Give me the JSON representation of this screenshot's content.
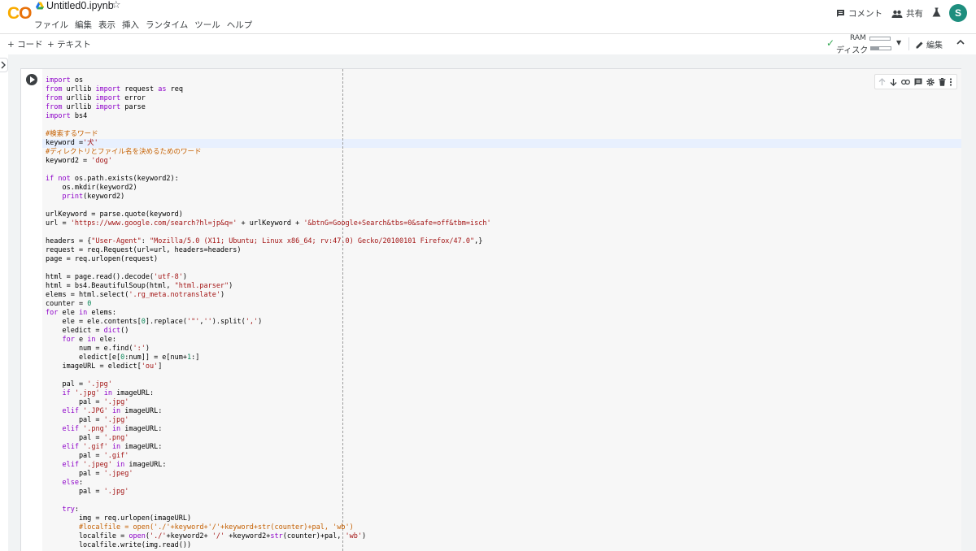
{
  "app": {
    "logo": {
      "part1": "C",
      "part2": "O"
    },
    "title": "Untitled0.ipynb",
    "star_glyph": "☆"
  },
  "menu": [
    "ファイル",
    "編集",
    "表示",
    "挿入",
    "ランタイム",
    "ツール",
    "ヘルプ"
  ],
  "header_actions": {
    "comment": "コメント",
    "share": "共有",
    "avatar_initial": "S"
  },
  "toolbar": {
    "add_code": "+ コード",
    "add_text": "+ テキスト",
    "ram_label": "RAM",
    "disk_label": "ディスク",
    "edit_label": "編集"
  },
  "cell": {
    "lines": [
      [
        [
          "kw",
          "import"
        ],
        [
          "p",
          " os"
        ]
      ],
      [
        [
          "kw",
          "from"
        ],
        [
          "p",
          " urllib "
        ],
        [
          "kw",
          "import"
        ],
        [
          "p",
          " request "
        ],
        [
          "kw",
          "as"
        ],
        [
          "p",
          " req"
        ]
      ],
      [
        [
          "kw",
          "from"
        ],
        [
          "p",
          " urllib "
        ],
        [
          "kw",
          "import"
        ],
        [
          "p",
          " error"
        ]
      ],
      [
        [
          "kw",
          "from"
        ],
        [
          "p",
          " urllib "
        ],
        [
          "kw",
          "import"
        ],
        [
          "p",
          " parse"
        ]
      ],
      [
        [
          "kw",
          "import"
        ],
        [
          "p",
          " bs4"
        ]
      ],
      [],
      [
        [
          "cmt",
          "#検索するワード"
        ]
      ],
      [
        [
          "p",
          "keyword ="
        ],
        [
          "str",
          "'犬'"
        ]
      ],
      [
        [
          "cmt",
          "#ディレクトリとファイル名を決めるためのワード"
        ]
      ],
      [
        [
          "p",
          "keyword2 = "
        ],
        [
          "str",
          "'dog'"
        ]
      ],
      [],
      [
        [
          "kw",
          "if not"
        ],
        [
          "p",
          " os.path.exists(keyword2):"
        ]
      ],
      [
        [
          "p",
          "    os.mkdir(keyword2)"
        ]
      ],
      [
        [
          "p",
          "    "
        ],
        [
          "kw",
          "print"
        ],
        [
          "p",
          "(keyword2)"
        ]
      ],
      [],
      [
        [
          "p",
          "urlKeyword = parse.quote(keyword)"
        ]
      ],
      [
        [
          "p",
          "url = "
        ],
        [
          "str",
          "'https://www.google.com/search?hl=jp&q='"
        ],
        [
          "p",
          " + urlKeyword + "
        ],
        [
          "str",
          "'&btnG=Google+Search&tbs=0&safe=off&tbm=isch'"
        ]
      ],
      [],
      [
        [
          "p",
          "headers = {"
        ],
        [
          "str",
          "\"User-Agent\""
        ],
        [
          "p",
          ": "
        ],
        [
          "str",
          "\"Mozilla/5.0 (X11; Ubuntu; Linux x86_64; rv:47.0) Gecko/20100101 Firefox/47.0\""
        ],
        [
          "p",
          ",}"
        ]
      ],
      [
        [
          "p",
          "request = req.Request(url=url, headers=headers)"
        ]
      ],
      [
        [
          "p",
          "page = req.urlopen(request)"
        ]
      ],
      [],
      [
        [
          "p",
          "html = page.read().decode("
        ],
        [
          "str",
          "'utf-8'"
        ],
        [
          "p",
          ")"
        ]
      ],
      [
        [
          "p",
          "html = bs4.BeautifulSoup(html, "
        ],
        [
          "str",
          "\"html.parser\""
        ],
        [
          "p",
          ")"
        ]
      ],
      [
        [
          "p",
          "elems = html.select("
        ],
        [
          "str",
          "'.rg_meta.notranslate'"
        ],
        [
          "p",
          ")"
        ]
      ],
      [
        [
          "p",
          "counter = "
        ],
        [
          "num",
          "0"
        ]
      ],
      [
        [
          "kw",
          "for"
        ],
        [
          "p",
          " ele "
        ],
        [
          "kw",
          "in"
        ],
        [
          "p",
          " elems:"
        ]
      ],
      [
        [
          "p",
          "    ele = ele.contents["
        ],
        [
          "num",
          "0"
        ],
        [
          "p",
          "].replace("
        ],
        [
          "str",
          "'\"'"
        ],
        [
          "p",
          ","
        ],
        [
          "str",
          "''"
        ],
        [
          "p",
          ").split("
        ],
        [
          "str",
          "','"
        ],
        [
          "p",
          ")"
        ]
      ],
      [
        [
          "p",
          "    eledict = "
        ],
        [
          "kw",
          "dict"
        ],
        [
          "p",
          "()"
        ]
      ],
      [
        [
          "p",
          "    "
        ],
        [
          "kw",
          "for"
        ],
        [
          "p",
          " e "
        ],
        [
          "kw",
          "in"
        ],
        [
          "p",
          " ele:"
        ]
      ],
      [
        [
          "p",
          "        num = e.find("
        ],
        [
          "str",
          "':'"
        ],
        [
          "p",
          ")"
        ]
      ],
      [
        [
          "p",
          "        eledict[e["
        ],
        [
          "num",
          "0"
        ],
        [
          "p",
          ":num]] = e[num+"
        ],
        [
          "num",
          "1"
        ],
        [
          "p",
          ":]"
        ]
      ],
      [
        [
          "p",
          "    imageURL = eledict["
        ],
        [
          "str",
          "'ou'"
        ],
        [
          "p",
          "]"
        ]
      ],
      [],
      [
        [
          "p",
          "    pal = "
        ],
        [
          "str",
          "'.jpg'"
        ]
      ],
      [
        [
          "p",
          "    "
        ],
        [
          "kw",
          "if"
        ],
        [
          "p",
          " "
        ],
        [
          "str",
          "'.jpg'"
        ],
        [
          "p",
          " "
        ],
        [
          "kw",
          "in"
        ],
        [
          "p",
          " imageURL:"
        ]
      ],
      [
        [
          "p",
          "        pal = "
        ],
        [
          "str",
          "'.jpg'"
        ]
      ],
      [
        [
          "p",
          "    "
        ],
        [
          "kw",
          "elif"
        ],
        [
          "p",
          " "
        ],
        [
          "str",
          "'.JPG'"
        ],
        [
          "p",
          " "
        ],
        [
          "kw",
          "in"
        ],
        [
          "p",
          " imageURL:"
        ]
      ],
      [
        [
          "p",
          "        pal = "
        ],
        [
          "str",
          "'.jpg'"
        ]
      ],
      [
        [
          "p",
          "    "
        ],
        [
          "kw",
          "elif"
        ],
        [
          "p",
          " "
        ],
        [
          "str",
          "'.png'"
        ],
        [
          "p",
          " "
        ],
        [
          "kw",
          "in"
        ],
        [
          "p",
          " imageURL:"
        ]
      ],
      [
        [
          "p",
          "        pal = "
        ],
        [
          "str",
          "'.png'"
        ]
      ],
      [
        [
          "p",
          "    "
        ],
        [
          "kw",
          "elif"
        ],
        [
          "p",
          " "
        ],
        [
          "str",
          "'.gif'"
        ],
        [
          "p",
          " "
        ],
        [
          "kw",
          "in"
        ],
        [
          "p",
          " imageURL:"
        ]
      ],
      [
        [
          "p",
          "        pal = "
        ],
        [
          "str",
          "'.gif'"
        ]
      ],
      [
        [
          "p",
          "    "
        ],
        [
          "kw",
          "elif"
        ],
        [
          "p",
          " "
        ],
        [
          "str",
          "'.jpeg'"
        ],
        [
          "p",
          " "
        ],
        [
          "kw",
          "in"
        ],
        [
          "p",
          " imageURL:"
        ]
      ],
      [
        [
          "p",
          "        pal = "
        ],
        [
          "str",
          "'.jpeg'"
        ]
      ],
      [
        [
          "p",
          "    "
        ],
        [
          "kw",
          "else"
        ],
        [
          "p",
          ":"
        ]
      ],
      [
        [
          "p",
          "        pal = "
        ],
        [
          "str",
          "'.jpg'"
        ]
      ],
      [],
      [
        [
          "p",
          "    "
        ],
        [
          "kw",
          "try"
        ],
        [
          "p",
          ":"
        ]
      ],
      [
        [
          "p",
          "        img = req.urlopen(imageURL)"
        ]
      ],
      [
        [
          "p",
          "        "
        ],
        [
          "cmt",
          "#localfile = open('./'+keyword+'/'+keyword+str(counter)+pal, 'wb')"
        ]
      ],
      [
        [
          "p",
          "        localfile = "
        ],
        [
          "kw",
          "open"
        ],
        [
          "p",
          "("
        ],
        [
          "str",
          "'./'"
        ],
        [
          "p",
          "+keyword2+ "
        ],
        [
          "str",
          "'/'"
        ],
        [
          "p",
          " +keyword2+"
        ],
        [
          "kw",
          "str"
        ],
        [
          "p",
          "(counter)+pal, "
        ],
        [
          "str",
          "'wb'"
        ],
        [
          "p",
          ")"
        ]
      ],
      [
        [
          "p",
          "        localfile.write(img.read())"
        ]
      ]
    ]
  },
  "colors": {
    "keyword": "#8d00c9",
    "string": "#a31515",
    "comment": "#c45f00",
    "number": "#098658",
    "avatar_bg": "#1e8e7e",
    "logo_orange": "#f9ab00"
  }
}
